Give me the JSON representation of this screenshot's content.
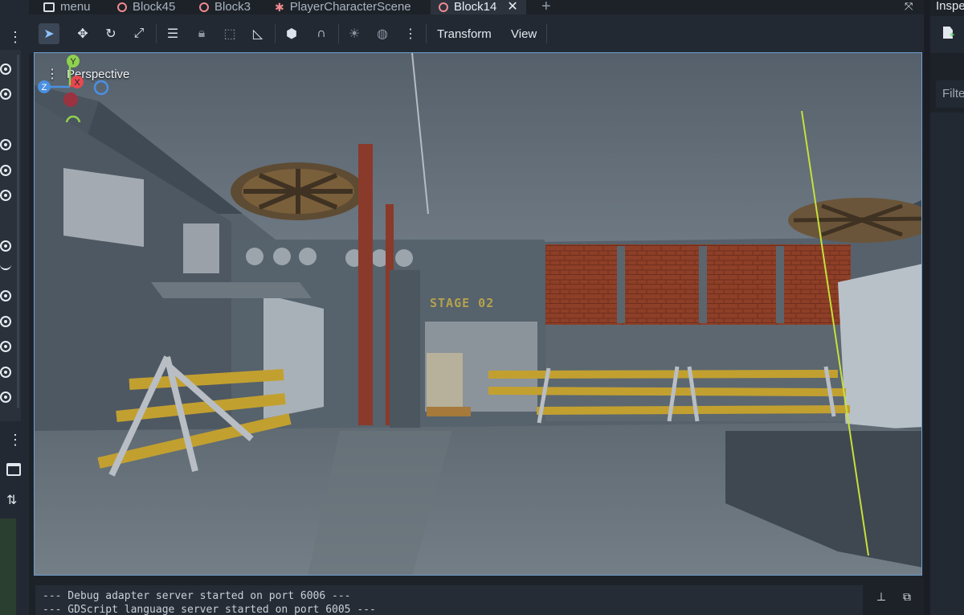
{
  "tabs": [
    {
      "label": "menu",
      "icon": "scene-icon"
    },
    {
      "label": "Block45",
      "icon": "node3d-icon"
    },
    {
      "label": "Block3",
      "icon": "node3d-icon"
    },
    {
      "label": "PlayerCharacterScene",
      "icon": "character-icon"
    },
    {
      "label": "Block14",
      "icon": "node3d-icon",
      "active": true
    }
  ],
  "toolbar": {
    "transform_label": "Transform",
    "view_label": "View"
  },
  "viewport": {
    "perspective_label": "Perspective",
    "stage_sign": "STAGE 02",
    "gizmo": {
      "x": "X",
      "y": "Y",
      "z": "Z"
    }
  },
  "output": {
    "lines": [
      "--- Debug adapter server started on port 6006 ---",
      "--- GDScript language server started on port 6005 ---"
    ]
  },
  "inspector": {
    "title": "Inspector",
    "filter_placeholder": "Filter Properties"
  },
  "colors": {
    "accent": "#6e9fd0",
    "tab_icon": "#f08a8f",
    "axis_x": "#e8484f",
    "axis_y": "#8fd14f",
    "axis_z": "#4a90e2"
  }
}
